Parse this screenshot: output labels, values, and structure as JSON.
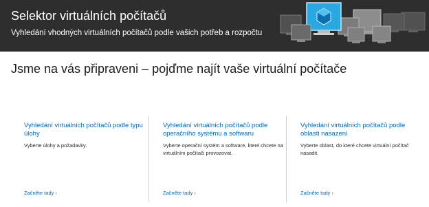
{
  "hero": {
    "title": "Selektor virtuálních počítačů",
    "subtitle": "Vyhledání vhodných virtuálních počítačů podle vašich potřeb a rozpočtu",
    "accent_color": "#29a7e1",
    "background_color": "#2e2e2e"
  },
  "main": {
    "heading": "Jsme na vás připraveni – pojďme najít vaše virtuální počítače"
  },
  "cards": [
    {
      "title": "Vyhledání virtuálních počítačů podle typu úlohy",
      "description": "Vyberte úlohy a požadavky.",
      "link": "Začněte tady"
    },
    {
      "title": "Vyhledání virtuálních počítačů podle operačního systému a softwaru",
      "description": "Vyberte operační systém a software, které chcete na virtuálním počítači provozovat.",
      "link": "Začněte tady"
    },
    {
      "title": "Vyhledání virtuálních počítačů podle oblasti nasazení",
      "description": "Vyberte oblast, do které chcete virtuální počítač nasadit.",
      "link": "Začněte tady"
    }
  ],
  "icons": {
    "link_chevron": "chevron-right-icon",
    "hero_art": "virtual-machine-monitors-illustration"
  }
}
